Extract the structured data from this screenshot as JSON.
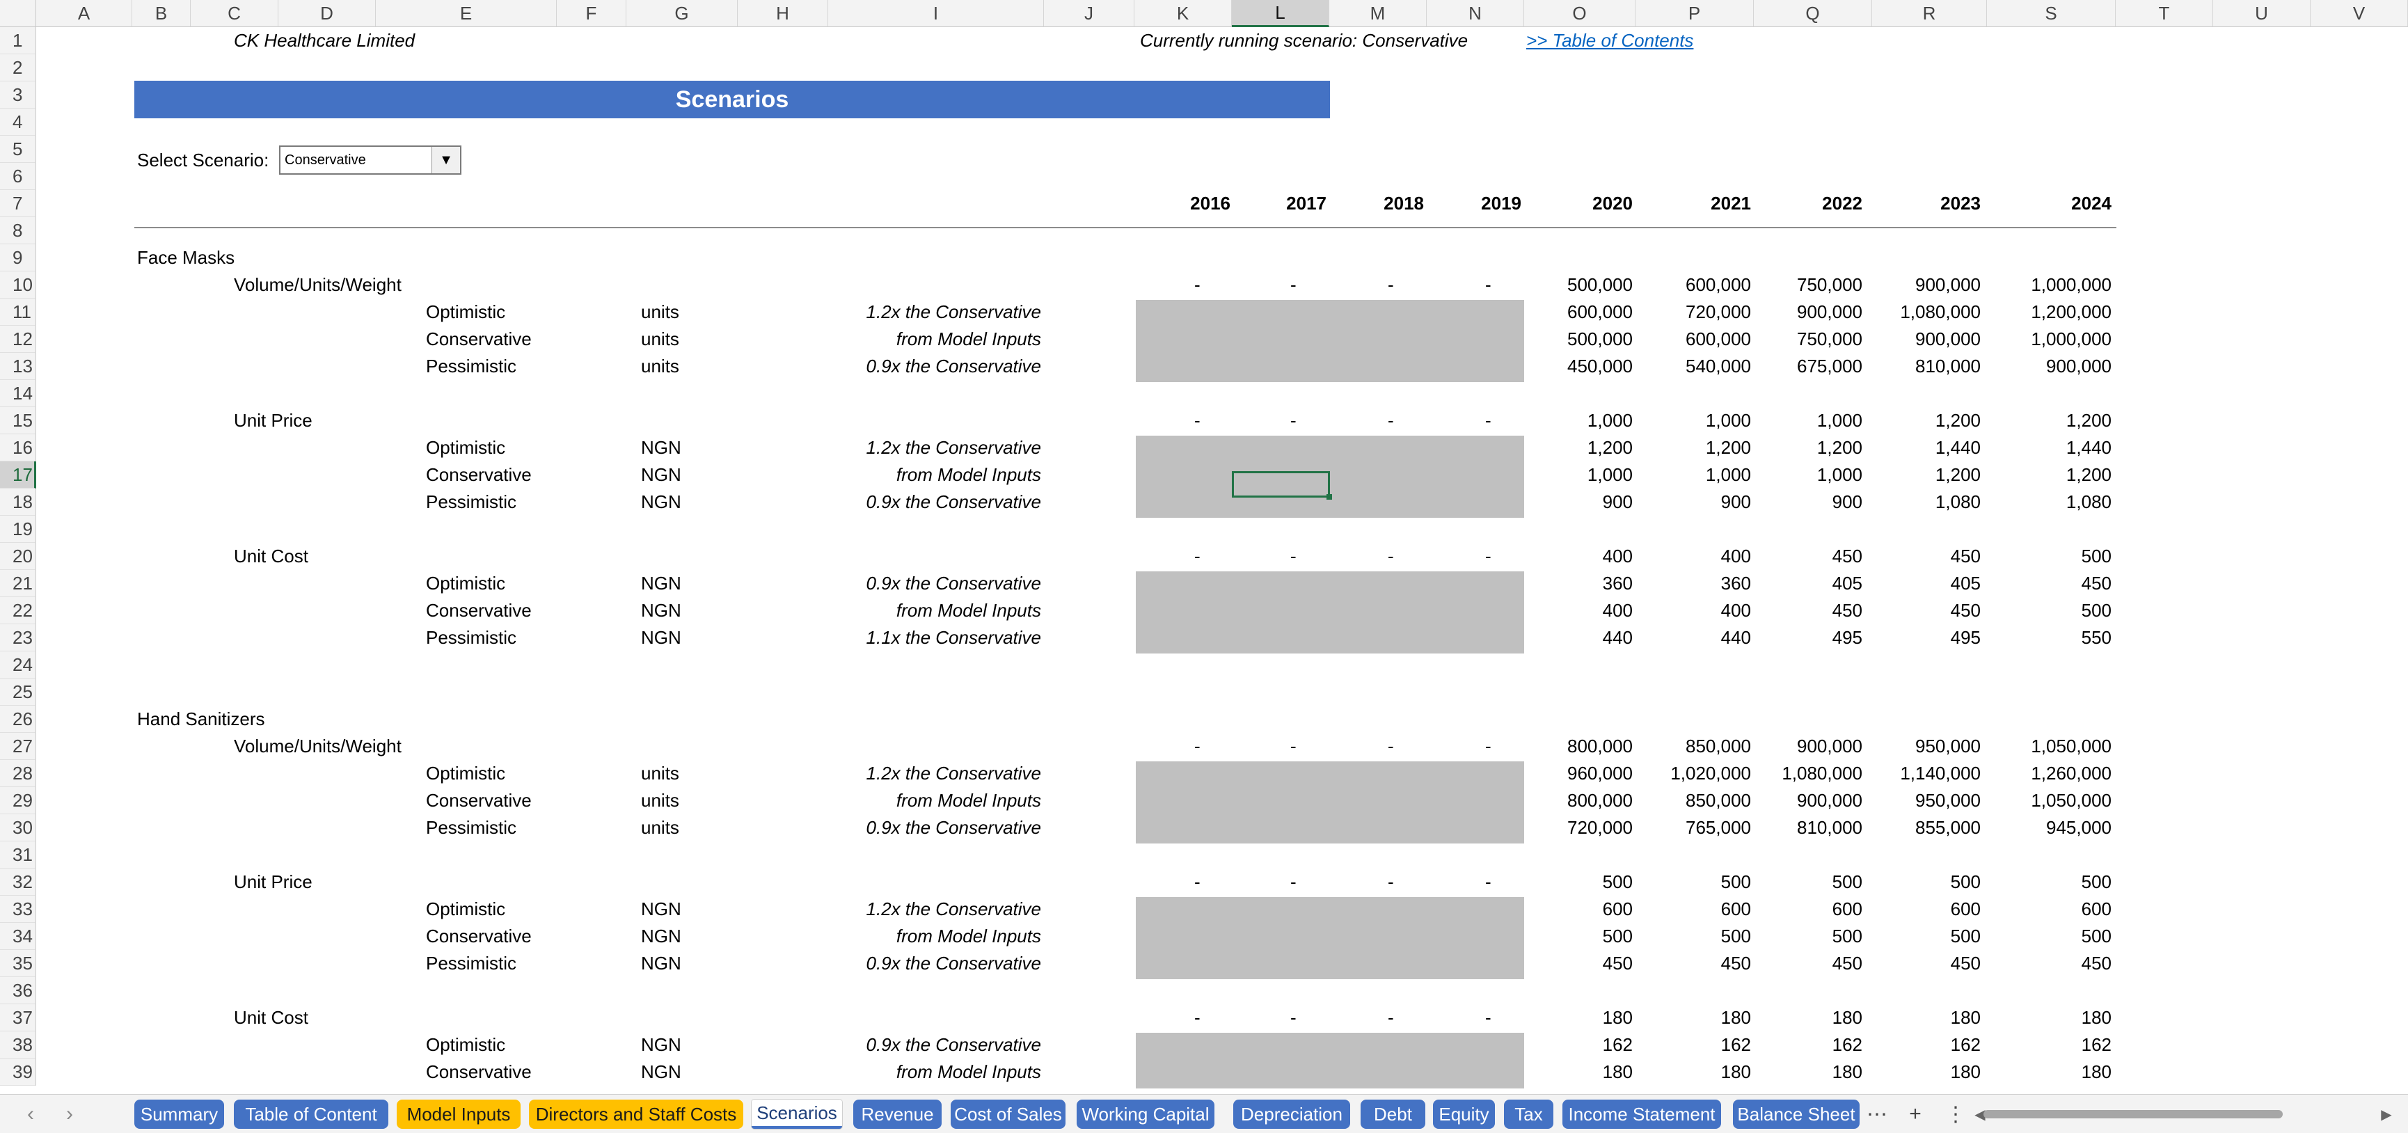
{
  "columns": [
    "A",
    "B",
    "C",
    "D",
    "E",
    "F",
    "G",
    "H",
    "I",
    "J",
    "K",
    "L",
    "M",
    "N",
    "O",
    "P",
    "Q",
    "R",
    "S",
    "T",
    "U",
    "V"
  ],
  "selected_column": "L",
  "rows": [
    "1",
    "2",
    "3",
    "4",
    "5",
    "6",
    "7",
    "8",
    "9",
    "10",
    "11",
    "12",
    "13",
    "14",
    "15",
    "16",
    "17",
    "18",
    "19",
    "20",
    "21",
    "22",
    "23",
    "24",
    "25",
    "26",
    "27",
    "28",
    "29",
    "30",
    "31",
    "32",
    "33",
    "34",
    "35",
    "36",
    "37",
    "38",
    "39"
  ],
  "selected_row": "17",
  "header": {
    "company": "CK Healthcare Limited",
    "running": "Currently running scenario: Conservative",
    "toc_link": ">> Table of Contents"
  },
  "banner": "Scenarios",
  "select": {
    "label": "Select Scenario:",
    "value": "Conservative"
  },
  "years": [
    "2016",
    "2017",
    "2018",
    "2019",
    "2020",
    "2021",
    "2022",
    "2023",
    "2024"
  ],
  "sections": [
    {
      "title": "Face Masks",
      "groups": [
        {
          "name": "Volume/Units/Weight",
          "top": [
            "-",
            "-",
            "-",
            "-",
            "500,000",
            "600,000",
            "750,000",
            "900,000",
            "1,000,000"
          ],
          "rows": [
            {
              "scenario": "Optimistic",
              "unit": "units",
              "note": "1.2x the Conservative",
              "values": [
                "600,000",
                "720,000",
                "900,000",
                "1,080,000",
                "1,200,000"
              ]
            },
            {
              "scenario": "Conservative",
              "unit": "units",
              "note": "from Model Inputs",
              "values": [
                "500,000",
                "600,000",
                "750,000",
                "900,000",
                "1,000,000"
              ]
            },
            {
              "scenario": "Pessimistic",
              "unit": "units",
              "note": "0.9x the Conservative",
              "values": [
                "450,000",
                "540,000",
                "675,000",
                "810,000",
                "900,000"
              ]
            }
          ]
        },
        {
          "name": "Unit Price",
          "top": [
            "-",
            "-",
            "-",
            "-",
            "1,000",
            "1,000",
            "1,000",
            "1,200",
            "1,200"
          ],
          "rows": [
            {
              "scenario": "Optimistic",
              "unit": "NGN",
              "note": "1.2x the Conservative",
              "values": [
                "1,200",
                "1,200",
                "1,200",
                "1,440",
                "1,440"
              ]
            },
            {
              "scenario": "Conservative",
              "unit": "NGN",
              "note": "from Model Inputs",
              "values": [
                "1,000",
                "1,000",
                "1,000",
                "1,200",
                "1,200"
              ]
            },
            {
              "scenario": "Pessimistic",
              "unit": "NGN",
              "note": "0.9x the Conservative",
              "values": [
                "900",
                "900",
                "900",
                "1,080",
                "1,080"
              ]
            }
          ]
        },
        {
          "name": "Unit Cost",
          "top": [
            "-",
            "-",
            "-",
            "-",
            "400",
            "400",
            "450",
            "450",
            "500"
          ],
          "rows": [
            {
              "scenario": "Optimistic",
              "unit": "NGN",
              "note": "0.9x the Conservative",
              "values": [
                "360",
                "360",
                "405",
                "405",
                "450"
              ]
            },
            {
              "scenario": "Conservative",
              "unit": "NGN",
              "note": "from Model Inputs",
              "values": [
                "400",
                "400",
                "450",
                "450",
                "500"
              ]
            },
            {
              "scenario": "Pessimistic",
              "unit": "NGN",
              "note": "1.1x the Conservative",
              "values": [
                "440",
                "440",
                "495",
                "495",
                "550"
              ]
            }
          ]
        }
      ]
    },
    {
      "title": "Hand Sanitizers",
      "groups": [
        {
          "name": "Volume/Units/Weight",
          "top": [
            "-",
            "-",
            "-",
            "-",
            "800,000",
            "850,000",
            "900,000",
            "950,000",
            "1,050,000"
          ],
          "rows": [
            {
              "scenario": "Optimistic",
              "unit": "units",
              "note": "1.2x the Conservative",
              "values": [
                "960,000",
                "1,020,000",
                "1,080,000",
                "1,140,000",
                "1,260,000"
              ]
            },
            {
              "scenario": "Conservative",
              "unit": "units",
              "note": "from Model Inputs",
              "values": [
                "800,000",
                "850,000",
                "900,000",
                "950,000",
                "1,050,000"
              ]
            },
            {
              "scenario": "Pessimistic",
              "unit": "units",
              "note": "0.9x the Conservative",
              "values": [
                "720,000",
                "765,000",
                "810,000",
                "855,000",
                "945,000"
              ]
            }
          ]
        },
        {
          "name": "Unit Price",
          "top": [
            "-",
            "-",
            "-",
            "-",
            "500",
            "500",
            "500",
            "500",
            "500"
          ],
          "rows": [
            {
              "scenario": "Optimistic",
              "unit": "NGN",
              "note": "1.2x the Conservative",
              "values": [
                "600",
                "600",
                "600",
                "600",
                "600"
              ]
            },
            {
              "scenario": "Conservative",
              "unit": "NGN",
              "note": "from Model Inputs",
              "values": [
                "500",
                "500",
                "500",
                "500",
                "500"
              ]
            },
            {
              "scenario": "Pessimistic",
              "unit": "NGN",
              "note": "0.9x the Conservative",
              "values": [
                "450",
                "450",
                "450",
                "450",
                "450"
              ]
            }
          ]
        },
        {
          "name": "Unit Cost",
          "top": [
            "-",
            "-",
            "-",
            "-",
            "180",
            "180",
            "180",
            "180",
            "180"
          ],
          "rows": [
            {
              "scenario": "Optimistic",
              "unit": "NGN",
              "note": "0.9x the Conservative",
              "values": [
                "162",
                "162",
                "162",
                "162",
                "162"
              ]
            },
            {
              "scenario": "Conservative",
              "unit": "NGN",
              "note": "from Model Inputs",
              "values": [
                "180",
                "180",
                "180",
                "180",
                "180"
              ]
            }
          ]
        }
      ]
    }
  ],
  "tabs": [
    {
      "label": "Summary",
      "color": "#4472c4"
    },
    {
      "label": "Table of Content",
      "color": "#4472c4"
    },
    {
      "label": "Model Inputs",
      "color": "#ffc000"
    },
    {
      "label": "Directors and Staff Costs",
      "color": "#ffc000"
    },
    {
      "label": "Scenarios",
      "active": true
    },
    {
      "label": "Revenue",
      "color": "#4472c4"
    },
    {
      "label": "Cost of Sales",
      "color": "#4472c4"
    },
    {
      "label": "Working Capital",
      "color": "#4472c4"
    },
    {
      "label": "Depreciation",
      "color": "#4472c4"
    },
    {
      "label": "Debt",
      "color": "#4472c4"
    },
    {
      "label": "Equity",
      "color": "#4472c4"
    },
    {
      "label": "Tax",
      "color": "#4472c4"
    },
    {
      "label": "Income Statement",
      "color": "#4472c4"
    },
    {
      "label": "Balance Sheet",
      "color": "#4472c4"
    }
  ],
  "tabbar_icons": {
    "prev": "chevron-left-icon",
    "next": "chevron-right-icon",
    "more": "ellipsis-icon",
    "add": "plus-icon",
    "options": "vertical-ellipsis-icon"
  },
  "tabbar_glyphs": {
    "prev": "‹",
    "next": "›",
    "more": "⋯",
    "add": "+",
    "options": "⋮",
    "scroll_left": "◀",
    "scroll_right": "▶"
  }
}
